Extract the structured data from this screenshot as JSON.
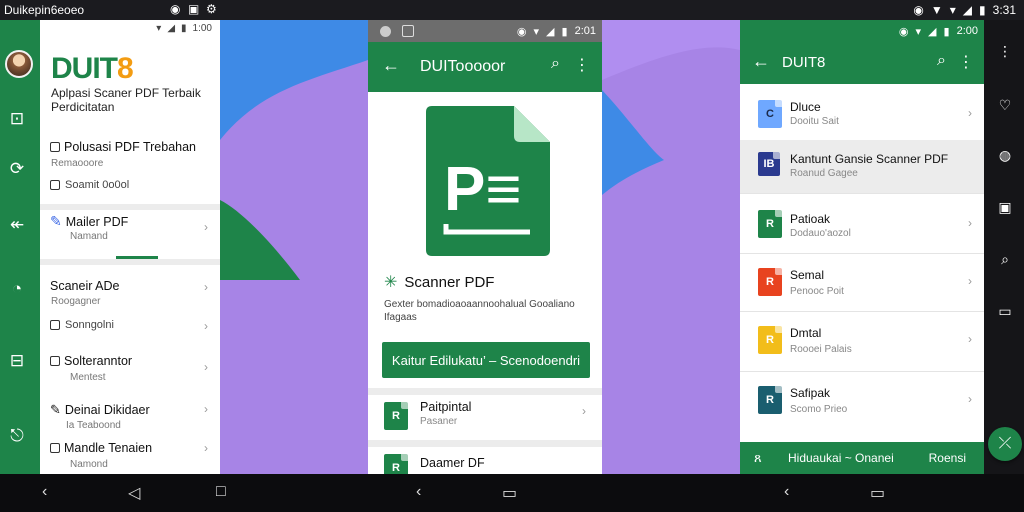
{
  "system_bar": {
    "title": "Duikepin6eoeo",
    "time": "3:31"
  },
  "rail": {
    "icons": [
      "image-icon",
      "refresh-icon",
      "back-arrow-icon",
      "clock-icon",
      "frame-icon",
      "share-icon"
    ]
  },
  "panel1": {
    "status_time": "1:00",
    "brand_prefix": "DUIT",
    "brand_suffix": "8",
    "tagline": "Aplpasi Scaner PDF Terbaik Perdicitatan",
    "items": [
      {
        "title": "Polusasi PDF Trebahan",
        "sub": "Remaooore",
        "small": "Soamit 0o0ol"
      },
      {
        "title": "Mailer PDF",
        "sub": "Namand"
      },
      {
        "title": "Scaneir ADe",
        "sub": "Roogagner"
      },
      {
        "title": "Sonngolni"
      },
      {
        "title": "Solteranntor",
        "sub": "Mentest"
      },
      {
        "title": "Deinai Dikidaer",
        "sub": "Ia Teaboond"
      },
      {
        "title": "Mandle Tenaien",
        "sub": "Namond"
      }
    ]
  },
  "panel2": {
    "status_time": "2:01",
    "app_bar_title": "DUITooooor",
    "logo_text": "P≡",
    "app_name": "Scanner PDF",
    "description": "Gexter bomadioaoaannoohalual Gooaliano Ifagaas",
    "cta_label": "Kaitur Edilukatu’ – Scenodoendri",
    "rows": [
      {
        "title": "Paitpintal",
        "sub": "Pasaner",
        "icon": "R"
      },
      {
        "title": "Daamer DF",
        "sub": "",
        "icon": "R"
      }
    ]
  },
  "panel3": {
    "status_time": "2:00",
    "app_bar_title": "DUIT8",
    "rows": [
      {
        "title": "Dluce",
        "sub": "Dooitu Sait",
        "icon": "C",
        "color": "#6fa8ff"
      },
      {
        "title": "Kantunt Gansie Scanner PDF",
        "sub": "Roanud Gagee",
        "icon": "IB",
        "color": "#2b3a8f",
        "highlight": true
      },
      {
        "title": "Patioak",
        "sub": "Dodauo'aozol",
        "icon": "R",
        "color": "#1e8449"
      },
      {
        "title": "Semal",
        "sub": "Penooc Poit",
        "icon": "R",
        "color": "#e8431f"
      },
      {
        "title": "Dmtal",
        "sub": "Roooei Palais",
        "icon": "R",
        "color": "#f2bd1a"
      },
      {
        "title": "Safipak",
        "sub": "Scomo Prieo",
        "icon": "R",
        "color": "#1a5e6f"
      }
    ],
    "bottom_label": "Hiduaukai ~ Onanei",
    "bottom_action": "Roensi"
  },
  "colors": {
    "brand_green": "#1e8449",
    "brand_orange": "#f39c12",
    "background_purple": "#a784e6",
    "background_blue": "#3e8ae6"
  }
}
